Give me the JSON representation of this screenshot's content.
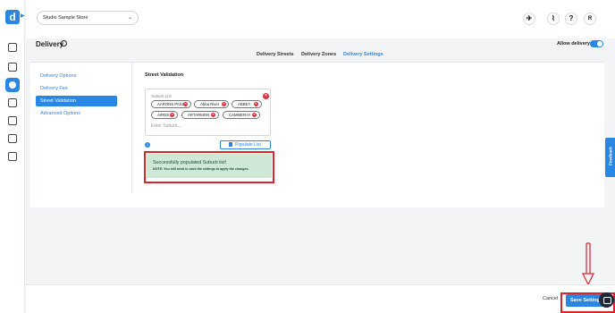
{
  "app": {
    "logo_letter": "d"
  },
  "topbar": {
    "store": "Studio Sample Store",
    "help_symbol": "?",
    "user_initial": "R"
  },
  "page": {
    "title": "Delivery",
    "allow_delivery_label": "Allow delivery",
    "allow_delivery_on": true
  },
  "tabs": [
    {
      "label": "Delivery Streets"
    },
    {
      "label": "Delivery Zones"
    },
    {
      "label": "Delivery Settings",
      "active": true
    }
  ],
  "sidebar": {
    "items": [
      {
        "label": "Delivery Options"
      },
      {
        "label": "Delivery Fee"
      },
      {
        "label": "Street Validation",
        "active": true
      },
      {
        "label": "Advanced Options"
      }
    ]
  },
  "street_validation": {
    "title": "Street Validation",
    "suburb_list_label": "Suburb List",
    "suburbs": [
      "AARONS PASS",
      "Abba River",
      "ABBEY",
      "AIRDS",
      "ARTARMON",
      "CAMMERAY"
    ],
    "input_placeholder": "Enter Suburb...",
    "info_symbol": "i",
    "populate_button": "Populate List"
  },
  "alert": {
    "message": "Successfully populated Suburb list!",
    "note": "NOTE: You still need to save the settings to apply the changes."
  },
  "feedback_tab": "Feedback",
  "footer": {
    "cancel": "Cancel",
    "save": "Save Settings"
  },
  "colors": {
    "accent": "#2a86e3",
    "highlight": "#d7262d",
    "success_bg": "#cfe8d6"
  }
}
